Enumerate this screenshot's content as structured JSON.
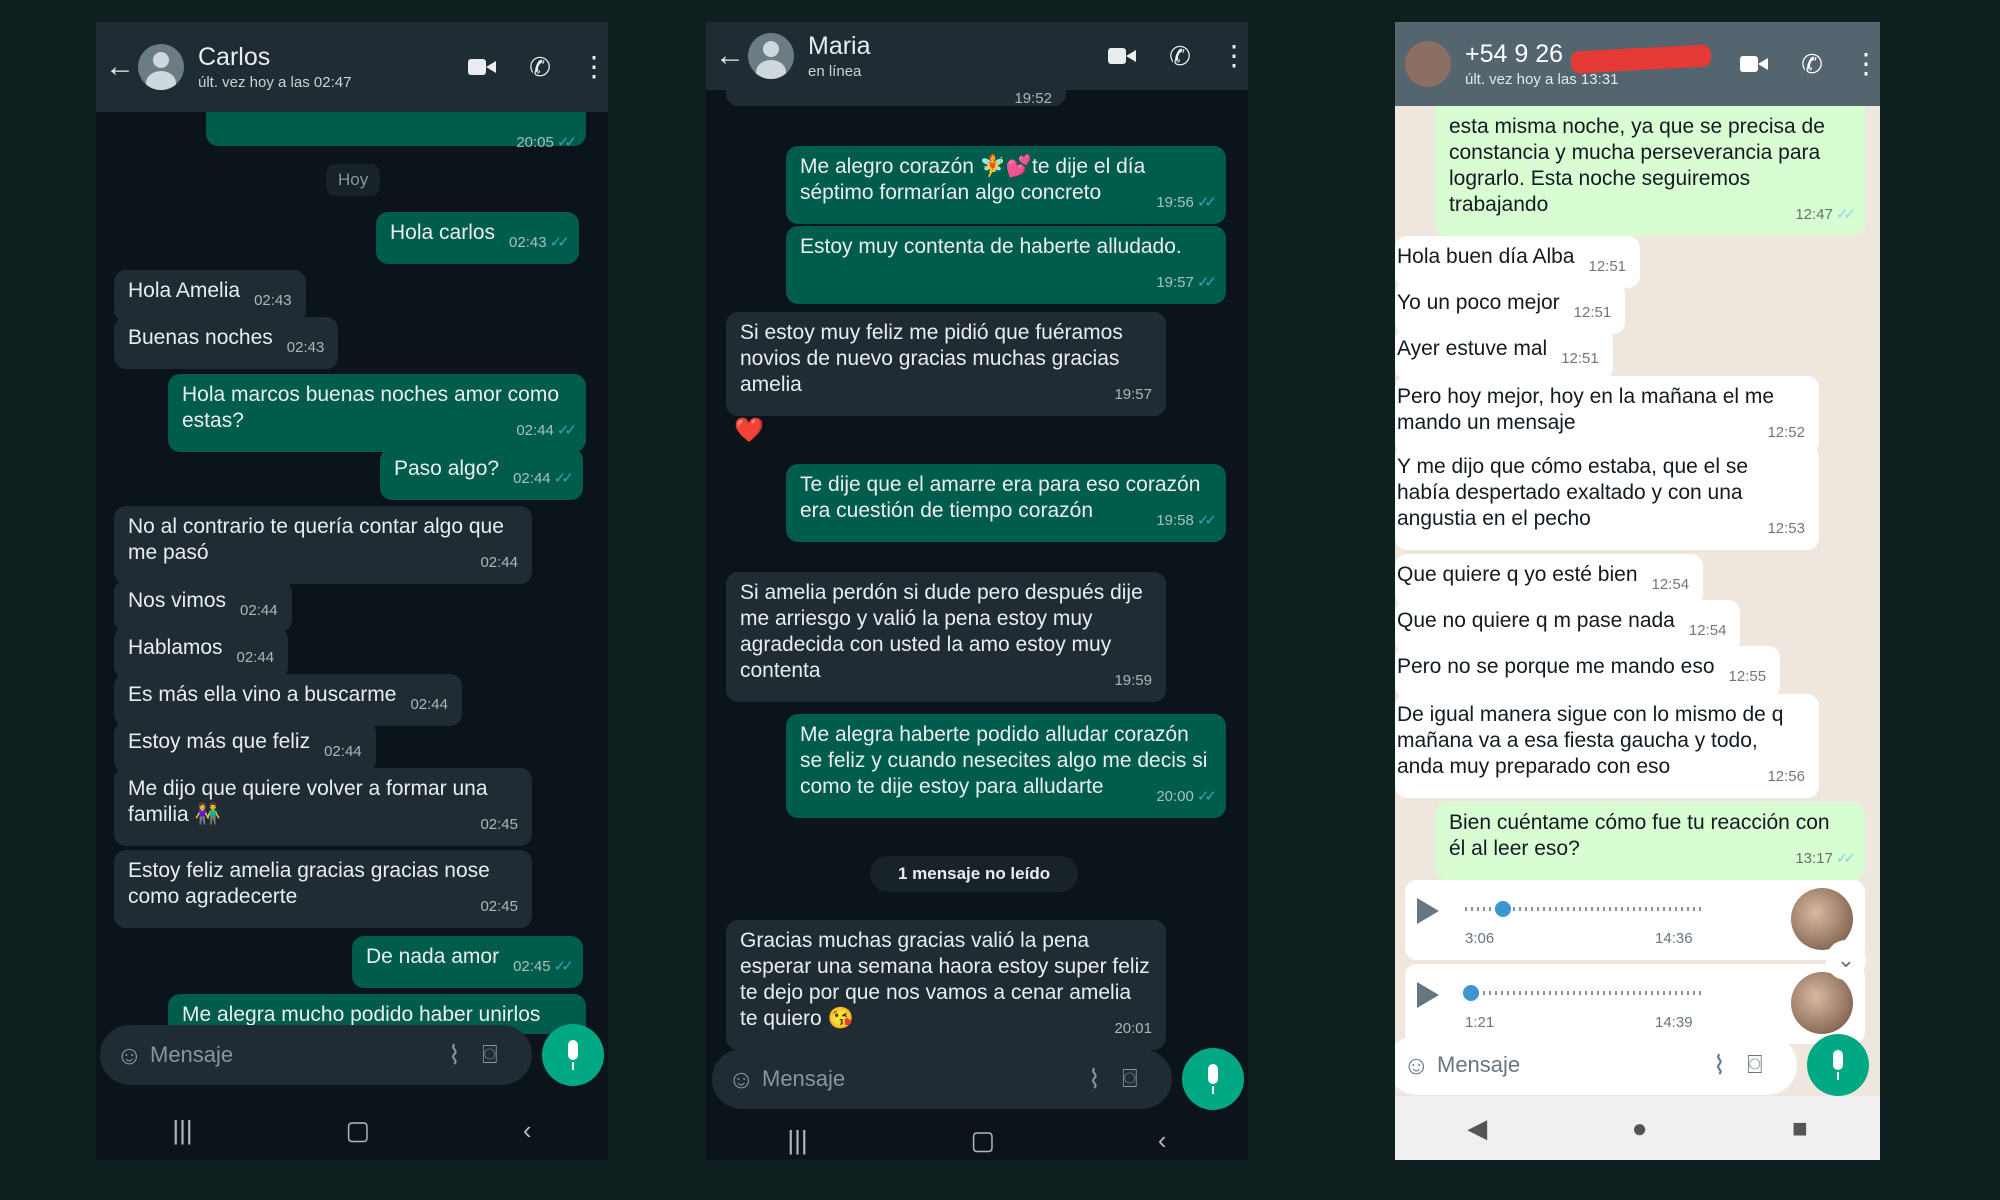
{
  "phone1": {
    "contact": "Carlos",
    "status": "últ. vez hoy a las 02:47",
    "day_pill": "Hoy",
    "first_time": "20:05",
    "messages": [
      {
        "text": "Hola carlos",
        "time": "02:43"
      },
      {
        "text": "Hola Amelia",
        "time": "02:43"
      },
      {
        "text": "Buenas noches",
        "time": "02:43"
      },
      {
        "text": "Hola marcos buenas noches amor como estas?",
        "time": "02:44"
      },
      {
        "text": "Paso algo?",
        "time": "02:44"
      },
      {
        "text": "No al contrario te quería contar algo que me pasó",
        "time": "02:44"
      },
      {
        "text": "Nos vimos",
        "time": "02:44"
      },
      {
        "text": "Hablamos",
        "time": "02:44"
      },
      {
        "text": "Es más ella vino a buscarme",
        "time": "02:44"
      },
      {
        "text": "Estoy más que feliz",
        "time": "02:44"
      },
      {
        "text": "Me dijo que quiere volver a formar una familia 👫",
        "time": "02:45"
      },
      {
        "text": "Estoy feliz amelia gracias gracias nose como agradecerte",
        "time": "02:45"
      },
      {
        "text": "De nada amor",
        "time": "02:45"
      },
      {
        "text": "Me alegra mucho podido haber unirlos",
        "time": ""
      }
    ],
    "input_placeholder": "Mensaje"
  },
  "phone2": {
    "contact": "Maria",
    "status": "en línea",
    "top_time": "19:52",
    "messages": [
      {
        "text": "Me alegro corazón 🧚💕te dije el día séptimo formarían algo concreto",
        "time": "19:56"
      },
      {
        "text": "Estoy muy contenta de haberte alludado.",
        "time": "19:57"
      },
      {
        "text": "Si estoy muy feliz me pidió que fuéramos novios de nuevo gracias muchas gracias amelia",
        "time": "19:57"
      },
      {
        "text": "Te dije que el amarre era para eso corazón era cuestión de tiempo corazón",
        "time": "19:58"
      },
      {
        "text": "Si amelia perdón si dude pero después dije me arriesgo y valió la pena estoy muy agradecida con usted la amo estoy muy contenta",
        "time": "19:59"
      },
      {
        "text": "Me alegra haberte podido alludar corazón se feliz y cuando nesecites algo me decis si como te dije estoy para alludarte",
        "time": "20:00"
      },
      {
        "text": "Gracias muchas gracias valió la pena esperar una semana haora estoy super feliz te dejo por que nos vamos a cenar amelia te quiero 😘",
        "time": "20:01"
      }
    ],
    "reaction": "❤️",
    "unread_pill": "1 mensaje no leído",
    "input_placeholder": "Mensaje"
  },
  "phone3": {
    "contact": "+54 9 26",
    "status": "últ. vez hoy a las 13:31",
    "messages": [
      {
        "text": "esta misma noche, ya que se precisa de constancia y mucha perseverancia para lograrlo. Esta noche seguiremos trabajando",
        "time": "12:47"
      },
      {
        "text": "Hola buen día Alba",
        "time": "12:51"
      },
      {
        "text": "Yo un poco mejor",
        "time": "12:51"
      },
      {
        "text": "Ayer estuve mal",
        "time": "12:51"
      },
      {
        "text": "Pero hoy mejor, hoy en la mañana el me mando un mensaje",
        "time": "12:52"
      },
      {
        "text": "Y me dijo que cómo estaba, que el se había despertado exaltado y con una angustia en el pecho",
        "time": "12:53"
      },
      {
        "text": "Que quiere q yo esté bien",
        "time": "12:54"
      },
      {
        "text": "Que no quiere q m pase nada",
        "time": "12:54"
      },
      {
        "text": "Pero no se porque me mando eso",
        "time": "12:55"
      },
      {
        "text": "De igual manera sigue con lo mismo de q mañana va a esa fiesta gaucha y todo, anda muy preparado con eso",
        "time": "12:56"
      },
      {
        "text": "Bien cuéntame cómo fue tu reacción con él al leer eso?",
        "time": "13:17"
      }
    ],
    "voice_notes": [
      {
        "duration": "3:06",
        "time": "14:36",
        "progress": 0.15
      },
      {
        "duration": "1:21",
        "time": "14:39",
        "progress": 0.0
      }
    ],
    "input_placeholder": "Mensaje"
  },
  "colors": {
    "tick": "#53bdeb",
    "mic": "#00a884",
    "redaction": "#e53935"
  }
}
